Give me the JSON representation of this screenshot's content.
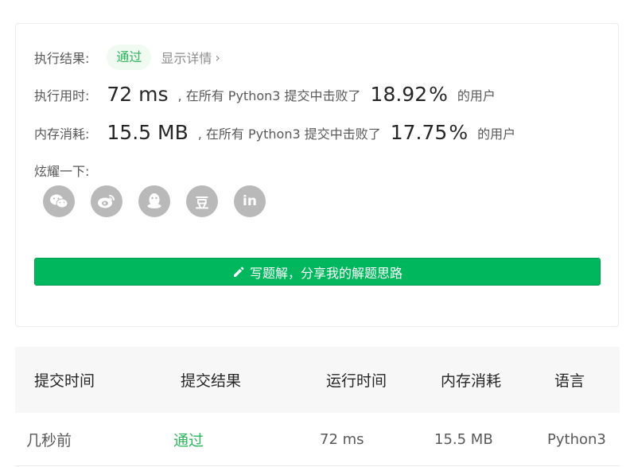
{
  "result": {
    "label": "执行结果:",
    "status": "通过",
    "detail_link": "显示详情",
    "detail_chevron": "›"
  },
  "runtime": {
    "label": "执行用时:",
    "value": "72 ms",
    "comment": ", 在所有 Python3 提交中击败了",
    "percent": "18.92",
    "percent_unit": "%",
    "suffix": "的用户"
  },
  "memory": {
    "label": "内存消耗:",
    "value": "15.5 MB",
    "comment": ", 在所有 Python3 提交中击败了",
    "percent": "17.75",
    "percent_unit": "%",
    "suffix": "的用户"
  },
  "share": {
    "label": "炫耀一下:",
    "buttons": [
      {
        "icon": "wechat-icon",
        "glyph": ""
      },
      {
        "icon": "weibo-icon",
        "glyph": ""
      },
      {
        "icon": "qq-icon",
        "glyph": ""
      },
      {
        "icon": "douban-icon",
        "glyph": "豆"
      },
      {
        "icon": "linkedin-icon",
        "glyph": "in"
      }
    ]
  },
  "write_solution": {
    "label": "写题解，分享我的解题思路",
    "icon": "pencil-icon"
  },
  "submissions": {
    "headers": [
      "提交时间",
      "提交结果",
      "运行时间",
      "内存消耗",
      "语言"
    ],
    "rows": [
      {
        "time": "几秒前",
        "result": "通过",
        "runtime": "72 ms",
        "memory": "15.5 MB",
        "language": "Python3"
      }
    ]
  },
  "colors": {
    "accent_green": "#2db55d",
    "button_green": "#00b75d",
    "share_gray": "#b9b9b9"
  }
}
